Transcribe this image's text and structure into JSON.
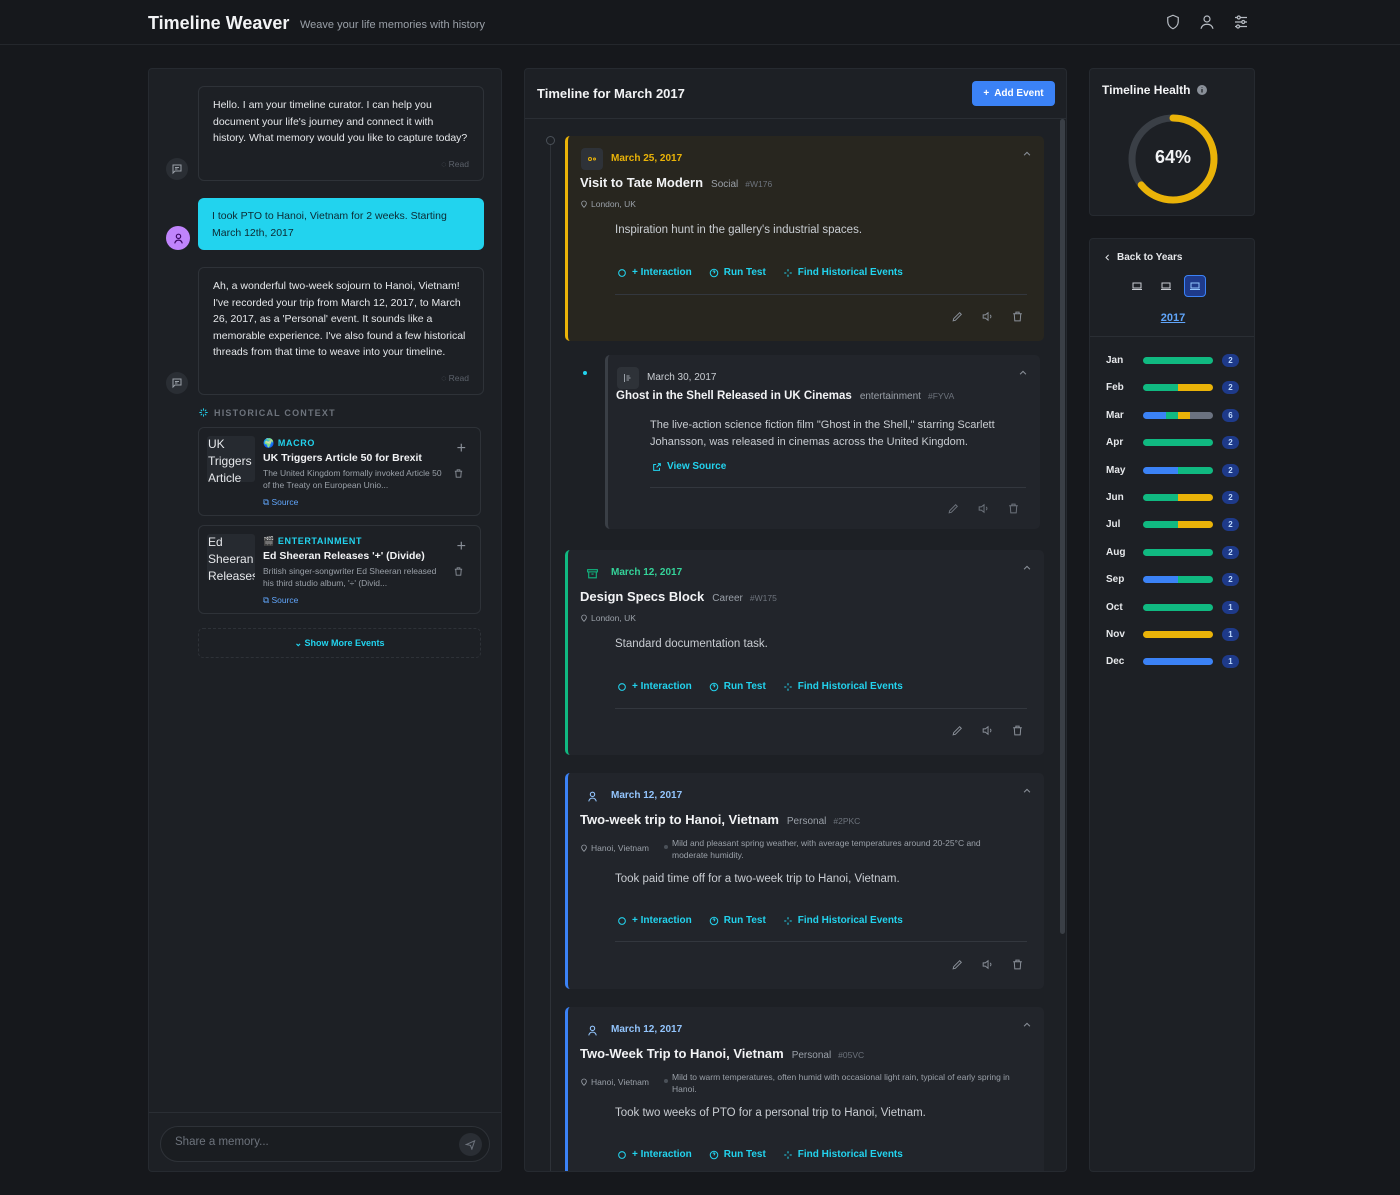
{
  "header": {
    "title": "Timeline Weaver",
    "tagline": "Weave your life memories with history"
  },
  "chat": {
    "messages": [
      {
        "role": "ai",
        "text": "Hello. I am your timeline curator. I can help you document your life's journey and connect it with history. What memory would you like to capture today?",
        "status": "Read"
      },
      {
        "role": "user",
        "text": "I took PTO to Hanoi, Vietnam for 2 weeks. Starting March 12th, 2017"
      },
      {
        "role": "ai",
        "text": "Ah, a wonderful two-week sojourn to Hanoi, Vietnam! I've recorded your trip from March 12, 2017, to March 26, 2017, as a 'Personal' event. It sounds like a memorable experience. I've also found a few historical threads from that time to weave into your timeline.",
        "status": "Read"
      }
    ],
    "historical_context_label": "HISTORICAL CONTEXT",
    "historical_items": [
      {
        "thumb_alt": "UK Triggers Article",
        "category": "MACRO",
        "title": "UK Triggers Article 50 for Brexit",
        "description": "The United Kingdom formally invoked Article 50 of the Treaty on European Unio...",
        "source": "Source"
      },
      {
        "thumb_alt": "Ed Sheeran Releases",
        "category": "ENTERTAINMENT",
        "title": "Ed Sheeran Releases '+' (Divide)",
        "description": "British singer-songwriter Ed Sheeran released his third studio album, '÷' (Divid...",
        "source": "Source"
      }
    ],
    "show_more": "Show More Events",
    "input_placeholder": "Share a memory..."
  },
  "timeline": {
    "title": "Timeline for March 2017",
    "add_button": "Add Event",
    "action_labels": {
      "interaction": "+ Interaction",
      "run_test": "Run Test",
      "find_historical": "Find Historical Events",
      "view_source": "View Source"
    },
    "events": [
      {
        "date": "March 25, 2017",
        "title": "Visit to Tate Modern",
        "category": "Social",
        "code": "#W176",
        "location": "London, UK",
        "description": "Inspiration hunt in the gallery's industrial spaces.",
        "date_color": "#eab308"
      },
      {
        "date": "March 30, 2017",
        "title": "Ghost in the Shell Released in UK Cinemas",
        "category": "entertainment",
        "code": "#FYVA",
        "description": "The live-action science fiction film \"Ghost in the Shell,\" starring Scarlett Johansson, was released in cinemas across the United Kingdom.",
        "date_color": "#c9cdd2"
      },
      {
        "date": "March 12, 2017",
        "title": "Design Specs Block",
        "category": "Career",
        "code": "#W175",
        "location": "London, UK",
        "description": "Standard documentation task.",
        "date_color": "#34d399"
      },
      {
        "date": "March 12, 2017",
        "title": "Two-week trip to Hanoi, Vietnam",
        "category": "Personal",
        "code": "#2PKC",
        "location": "Hanoi, Vietnam",
        "weather": "Mild and pleasant spring weather, with average temperatures around 20-25°C and moderate humidity.",
        "description": "Took paid time off for a two-week trip to Hanoi, Vietnam.",
        "date_color": "#93c5fd"
      },
      {
        "date": "March 12, 2017",
        "title": "Two-Week Trip to Hanoi, Vietnam",
        "category": "Personal",
        "code": "#05VC",
        "location": "Hanoi, Vietnam",
        "weather": "Mild to warm temperatures, often humid with occasional light rain, typical of early spring in Hanoi.",
        "description": "Took two weeks of PTO for a personal trip to Hanoi, Vietnam.",
        "date_color": "#93c5fd"
      }
    ]
  },
  "health": {
    "title": "Timeline Health",
    "value_label": "64%",
    "value": 0.64,
    "color": "#eab308"
  },
  "months_panel": {
    "back_label": "Back to Years",
    "year": "2017",
    "colors": {
      "green": "#10b981",
      "yellow": "#eab308",
      "blue": "#3b82f6",
      "gray": "#6b7280"
    },
    "months": [
      {
        "name": "Jan",
        "count": "2",
        "segments": [
          [
            "green",
            1
          ]
        ]
      },
      {
        "name": "Feb",
        "count": "2",
        "segments": [
          [
            "green",
            0.5
          ],
          [
            "yellow",
            0.5
          ]
        ]
      },
      {
        "name": "Mar",
        "count": "6",
        "segments": [
          [
            "blue",
            0.33
          ],
          [
            "green",
            0.17
          ],
          [
            "yellow",
            0.17
          ],
          [
            "gray",
            0.33
          ]
        ]
      },
      {
        "name": "Apr",
        "count": "2",
        "segments": [
          [
            "green",
            1
          ]
        ]
      },
      {
        "name": "May",
        "count": "2",
        "segments": [
          [
            "blue",
            0.5
          ],
          [
            "green",
            0.5
          ]
        ]
      },
      {
        "name": "Jun",
        "count": "2",
        "segments": [
          [
            "green",
            0.5
          ],
          [
            "yellow",
            0.5
          ]
        ]
      },
      {
        "name": "Jul",
        "count": "2",
        "segments": [
          [
            "green",
            0.5
          ],
          [
            "yellow",
            0.5
          ]
        ]
      },
      {
        "name": "Aug",
        "count": "2",
        "segments": [
          [
            "green",
            1
          ]
        ]
      },
      {
        "name": "Sep",
        "count": "2",
        "segments": [
          [
            "blue",
            0.5
          ],
          [
            "green",
            0.5
          ]
        ]
      },
      {
        "name": "Oct",
        "count": "1",
        "segments": [
          [
            "green",
            1
          ]
        ]
      },
      {
        "name": "Nov",
        "count": "1",
        "segments": [
          [
            "yellow",
            1
          ]
        ]
      },
      {
        "name": "Dec",
        "count": "1",
        "segments": [
          [
            "blue",
            1
          ]
        ]
      }
    ]
  }
}
